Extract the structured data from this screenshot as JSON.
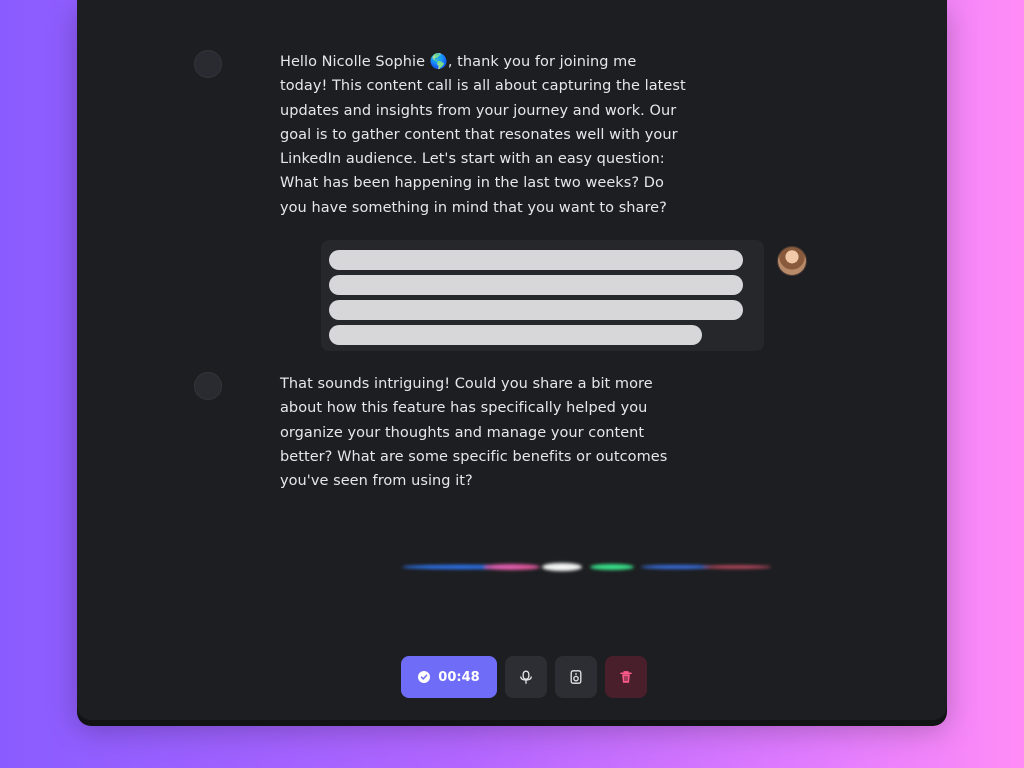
{
  "chat": {
    "assistant_message_1": "Hello Nicolle Sophie 🌎, thank you for joining me today! This content call is all about capturing the latest updates and insights from your journey and work. Our goal is to gather content that resonates well with your LinkedIn audience. Let's start with an easy question: What has been happening in the last two weeks? Do you have something in mind that you want to share?",
    "assistant_message_2": "That sounds intriguing! Could you share a bit more about how this feature has specifically helped you organize your thoughts and manage your content better? What are some specific benefits or outcomes you've seen from using it?"
  },
  "controls": {
    "timer": "00:48",
    "icons": [
      "check-circle-icon",
      "microphone-icon",
      "speaker-icon",
      "trash-icon"
    ]
  },
  "colors": {
    "background_gradient_start": "#8a5cff",
    "background_gradient_end": "#ff8cf6",
    "window_bg": "#1d1e21",
    "accent": "#6f6cf7",
    "danger": "#ff5a8a"
  }
}
